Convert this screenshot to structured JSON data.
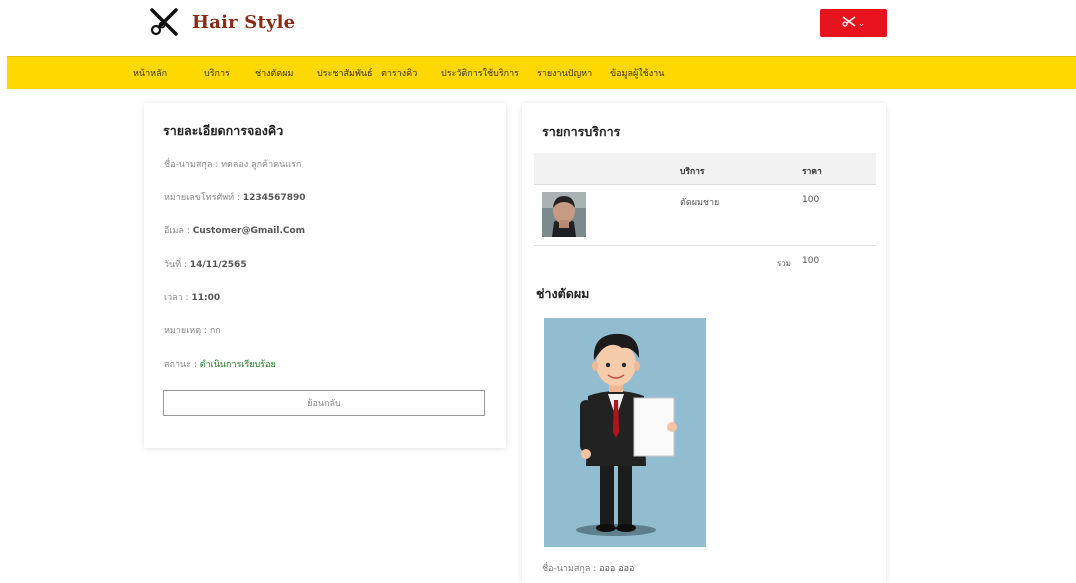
{
  "header": {
    "logo_text": "Hair Style",
    "menu_caret": "⌄"
  },
  "nav": {
    "items": [
      "หน้าหลัก",
      "บริการ",
      "ช่างตัดผม",
      "ประชาสัมพันธ์",
      "ตารางคิว",
      "ประวัติการใช้บริการ",
      "รายงานปัญหา",
      "ข้อมูลผู้ใช้งาน"
    ]
  },
  "booking": {
    "title": "รายละเอียดการจองคิว",
    "name_label": "ชื่อ-นามสกุล : ",
    "name_value": "ทดลอง ลูกค้าคนแรก",
    "phone_label": "หมายเลขโทรศัพท์ : ",
    "phone_value": "1234567890",
    "email_label": "อีเมล : ",
    "email_value": "Customer@Gmail.Com",
    "date_label": "วันที่ : ",
    "date_value": "14/11/2565",
    "time_label": "เวลา : ",
    "time_value": "11:00",
    "note_label": "หมายเหตุ : ",
    "note_value": "กก",
    "status_label": "สถานะ : ",
    "status_value": "ดำเนินการเรียบร้อย",
    "back_button": "ย้อนกลับ"
  },
  "services": {
    "title": "รายการบริการ",
    "columns": [
      "บริการ",
      "ราคา"
    ],
    "rows": [
      {
        "service": "ตัดผมชาย",
        "price": "100"
      }
    ],
    "total_label": "รวม",
    "total_value": "100"
  },
  "barber": {
    "title": "ช่างตัดผม",
    "name_label": "ชื่อ-นามสกุล : ",
    "name_value": "อออ อออ"
  },
  "colors": {
    "navbar": "#ffd800",
    "menu_button": "#e8131c",
    "status_green": "#1b7a1b",
    "logo_text": "#8a2a14"
  },
  "icons": {
    "logo": "scissors-icon",
    "menu": "scissors-icon"
  }
}
